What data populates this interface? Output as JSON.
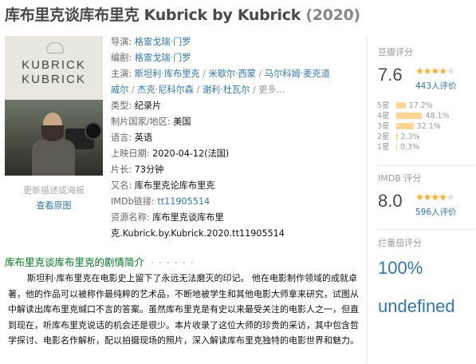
{
  "header": {
    "title": "库布里克谈库布里克 Kubrick by Kubrick",
    "year": "(2020)"
  },
  "poster": {
    "text_line1": "KUBRICK",
    "text_line2": "KUBRICK",
    "caption": "更新描述或海报",
    "view_link": "查看原图"
  },
  "info": {
    "director_label": "导演:",
    "director": "格雷戈瑞·门罗",
    "writer_label": "编剧:",
    "writer": "格雷戈瑞·门罗",
    "cast_label": "主演:",
    "cast": [
      "斯坦利·库布里克",
      "米歇尔·西蒙",
      "马尔科姆·麦克道威尔",
      "杰克·尼科尔森",
      "谢利·杜瓦尔"
    ],
    "cast_line1_tail": "马尔科姆·麦克道",
    "cast_line2_head": "威尔",
    "more": "更多...",
    "genre_label": "类型:",
    "genre": "纪录片",
    "country_label": "制片国家/地区:",
    "country": "美国",
    "language_label": "语言:",
    "language": "英语",
    "release_label": "上映日期:",
    "release": "2020-04-12(法国)",
    "runtime_label": "片长:",
    "runtime": "73分钟",
    "aka_label": "又名:",
    "aka": "库布里克论库布里克",
    "imdb_label": "IMDb链接:",
    "imdb": "tt11905514",
    "resource_label": "资源名称:",
    "resource_line1": "库布里克谈库布里",
    "resource_line2": "克.Kubrick.by.Kubrick.2020.tt11905514"
  },
  "rating": {
    "douban_label": "豆瓣评分",
    "douban_score": "7.6",
    "douban_count": "443人评价",
    "distribution": [
      {
        "star": "5星",
        "pct": "17.2%",
        "value": 17.2
      },
      {
        "star": "4星",
        "pct": "48.1%",
        "value": 48.1
      },
      {
        "star": "3星",
        "pct": "32.1%",
        "value": 32.1
      },
      {
        "star": "2星",
        "pct": "2.3%",
        "value": 2.3
      },
      {
        "star": "1星",
        "pct": "0.3%",
        "value": 0.3
      }
    ],
    "imdb_label": "IMDB 评分",
    "imdb_score": "8.0",
    "imdb_count": "596人评价",
    "rt_label": "烂番茄评分",
    "rt_percent": "100%",
    "rt_extra": "undefined",
    "star_color": "#ffac2d"
  },
  "synopsis": {
    "title": "库布里克谈库布里克的剧情简介",
    "dots": "· · · · · ·",
    "body": "斯坦利·库布里克在电影史上留下了永远无法磨灭的印记。 他在电影制作领域的成就卓著，他的作品可以被称作最纯粹的艺术品，不断地被学生和其他电影大师拿来研究，试图从中解读出库布里克缄口不言的答案。虽然库布里克是有史以来最受关注的电影人之一，但直到现在，听库布里克说话的机会还是很少。本片收录了这位大师的珍贵的采访，其中包含哲学探讨、电影名作解析，配以拍摄现场的照片，深入解读库布里克独特的电影世界和魅力。"
  }
}
